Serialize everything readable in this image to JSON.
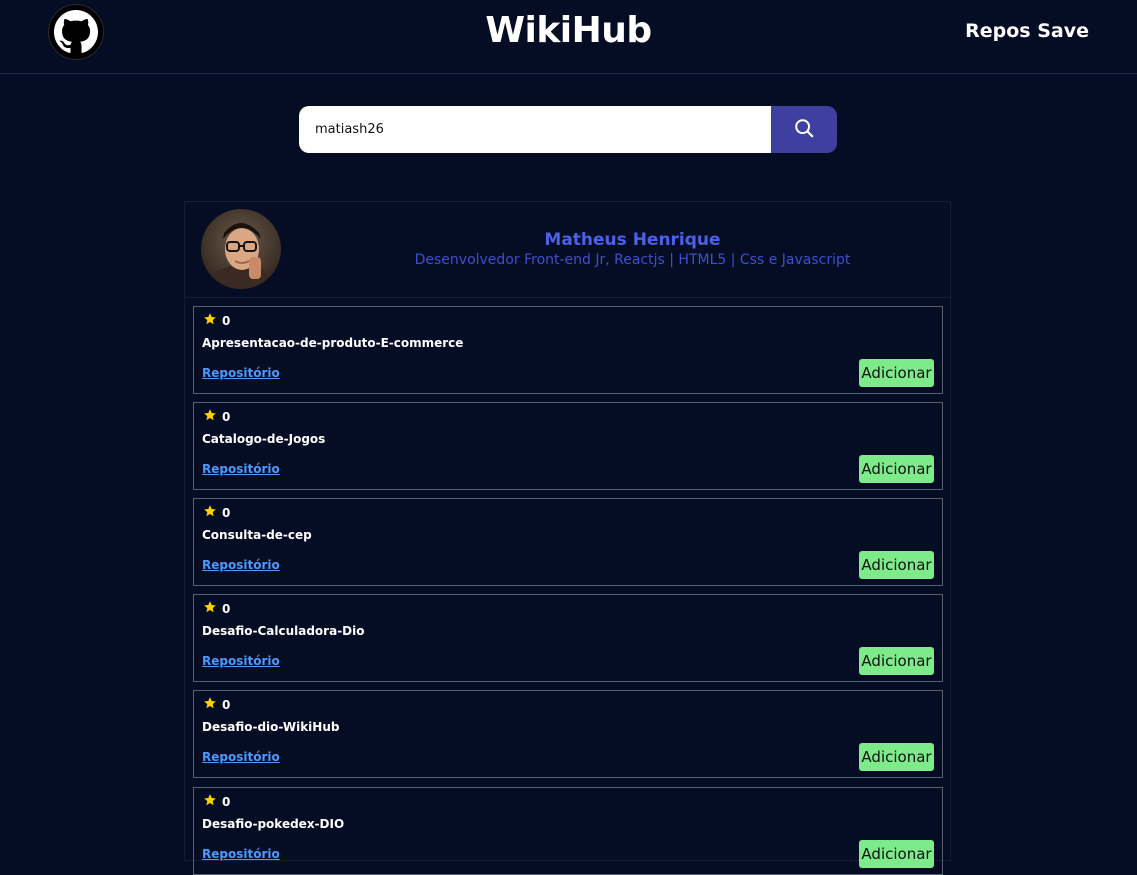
{
  "header": {
    "logo_icon": "github-icon",
    "brand": "WikiHub",
    "nav_link": "Repos Save"
  },
  "search": {
    "value": "matiash26",
    "button_icon": "search-icon",
    "button_color": "#3f3fa0"
  },
  "profile": {
    "name": "Matheus Henrique",
    "bio": "Desenvolvedor Front-end Jr, Reactjs | HTML5 | Css e Javascript",
    "name_color": "#4b62e6"
  },
  "repos": [
    {
      "stars": "0",
      "name": "Apresentacao-de-produto-E-commerce",
      "link": "Repositório",
      "button": "Adicionar"
    },
    {
      "stars": "0",
      "name": "Catalogo-de-Jogos",
      "link": "Repositório",
      "button": "Adicionar"
    },
    {
      "stars": "0",
      "name": "Consulta-de-cep",
      "link": "Repositório",
      "button": "Adicionar"
    },
    {
      "stars": "0",
      "name": "Desafio-Calculadora-Dio",
      "link": "Repositório",
      "button": "Adicionar"
    },
    {
      "stars": "0",
      "name": "Desafio-dio-WikiHub",
      "link": "Repositório",
      "button": "Adicionar"
    },
    {
      "stars": "0",
      "name": "Desafio-pokedex-DIO",
      "link": "Repositório",
      "button": "Adicionar"
    }
  ],
  "colors": {
    "background": "#050d24",
    "add_button": "#7deb8a",
    "link": "#4a9aff",
    "star": "#ffd000"
  }
}
